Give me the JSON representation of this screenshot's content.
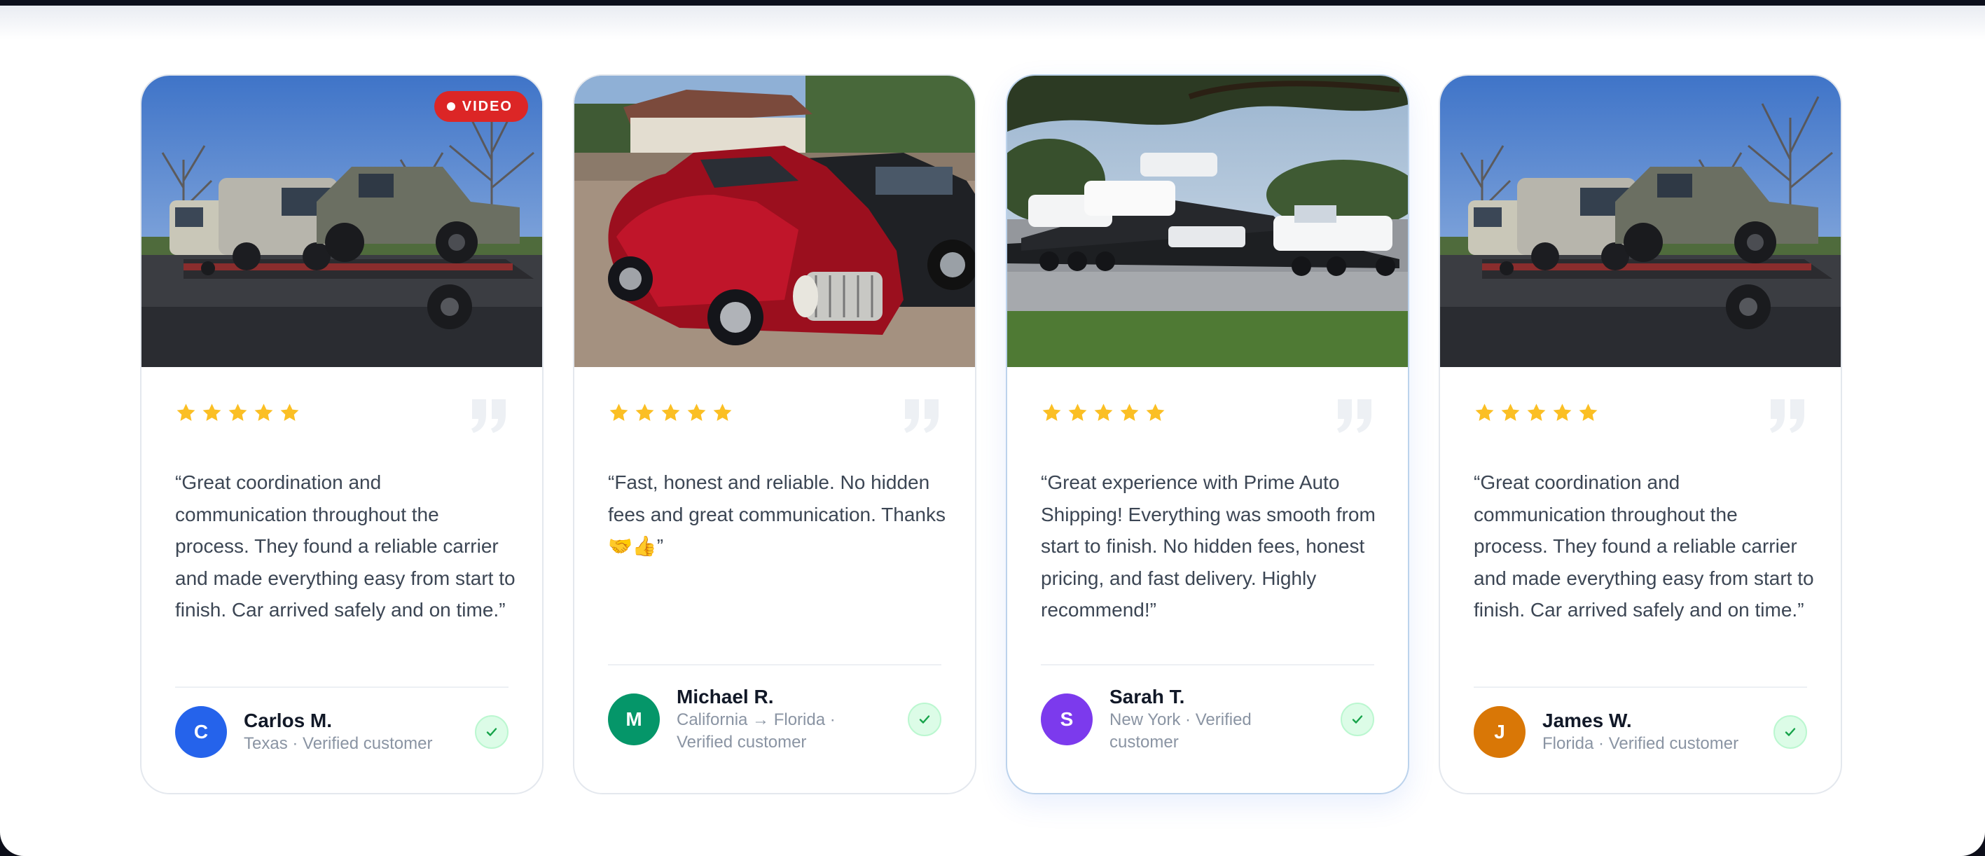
{
  "colors": {
    "star": "#fbbf24",
    "quote_mark": "#edf0f4",
    "video_badge": "#dc2626",
    "verified_bg": "#dcfce7",
    "verified_check": "#16a34a"
  },
  "testimonials": [
    {
      "has_video": true,
      "video_label": "VIDEO",
      "photo": "car-carrier-trailer-with-van-and-jeep",
      "rating": 5,
      "quote": "“Great coordination and communication throughout the process. They found a reliable carrier and made everything easy from start to finish. Car arrived safely and on time.”",
      "avatar_initial": "C",
      "avatar_color": "#2563eb",
      "name": "Carlos M.",
      "meta": "Texas · Verified customer"
    },
    {
      "has_video": false,
      "photo": "red-vintage-hot-rod-coupe",
      "rating": 5,
      "quote": "“Fast, honest and reliable. No hidden fees and great communication. Thanks 🤝👍”",
      "avatar_initial": "M",
      "avatar_color": "#059669",
      "name": "Michael R.",
      "meta": "California → Florida · Verified customer"
    },
    {
      "has_video": false,
      "featured": true,
      "photo": "car-hauler-loaded-with-white-pickups",
      "rating": 5,
      "quote": "“Great experience with Prime Auto Shipping! Everything was smooth from start to finish. No hidden fees, honest pricing, and fast delivery. Highly recommend!”",
      "avatar_initial": "S",
      "avatar_color": "#7c3aed",
      "name": "Sarah T.",
      "meta": "New York · Verified customer"
    },
    {
      "has_video": false,
      "photo": "car-carrier-trailer-with-van-and-jeep",
      "rating": 5,
      "quote": "“Great coordination and communication throughout the process. They found a reliable carrier and made everything easy from start to finish. Car arrived safely and on time.”",
      "avatar_initial": "J",
      "avatar_color": "#d97706",
      "name": "James W.",
      "meta": "Florida · Verified customer"
    }
  ]
}
